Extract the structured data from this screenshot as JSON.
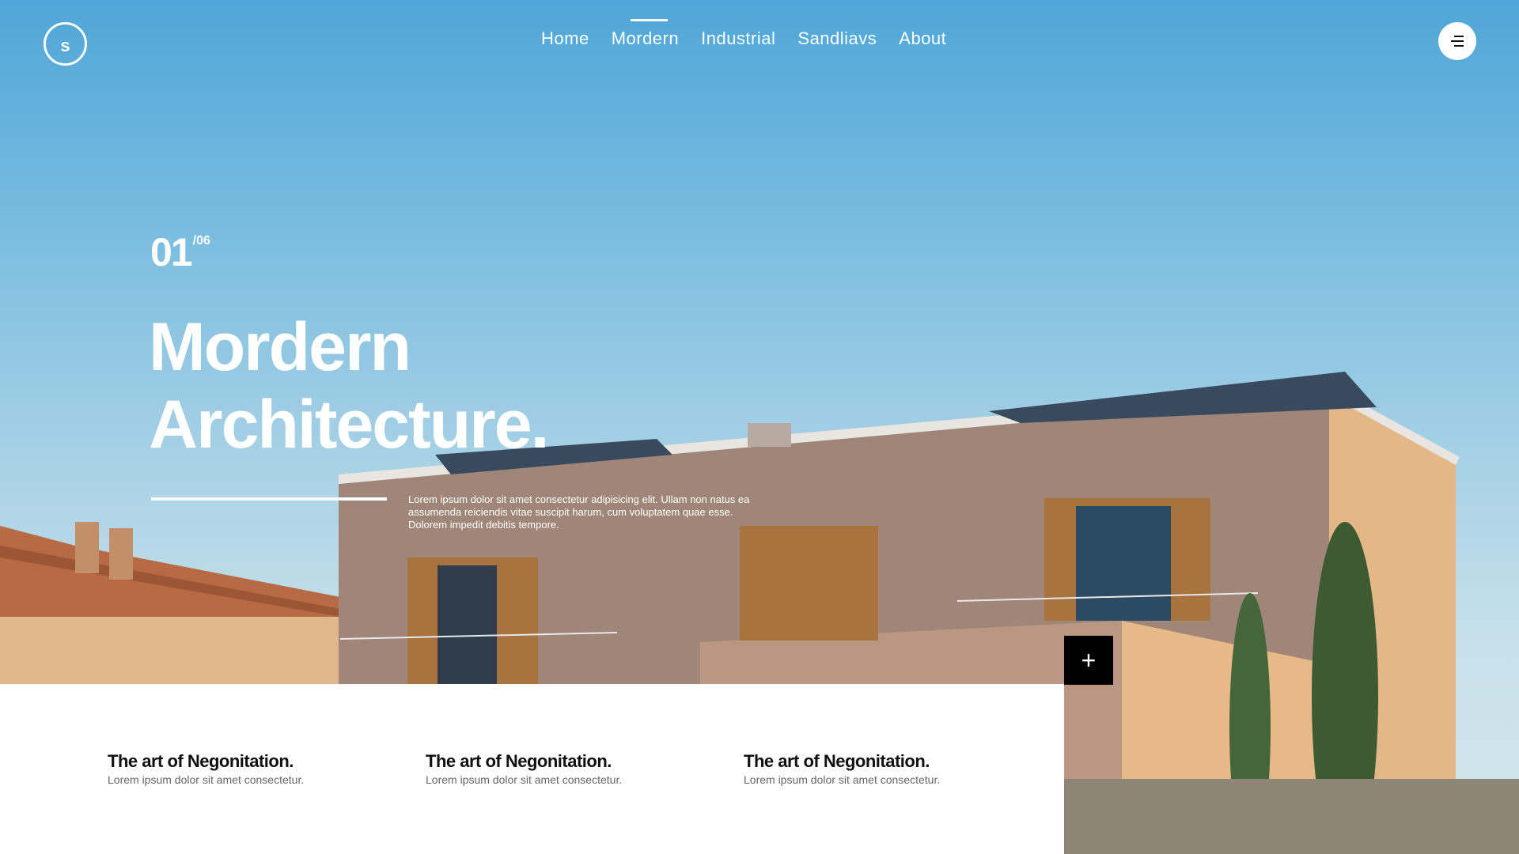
{
  "brand": {
    "logo_letter": "s"
  },
  "nav": {
    "items": [
      {
        "label": "Home"
      },
      {
        "label": "Mordern"
      },
      {
        "label": "Industrial"
      },
      {
        "label": "Sandliavs"
      },
      {
        "label": "About"
      }
    ],
    "active": "Mordern"
  },
  "hero": {
    "counter": {
      "current": "01",
      "total": "/06"
    },
    "title_line1": "Mordern",
    "title_line2": "Architecture.",
    "description": "Lorem ipsum dolor sit amet consectetur adipisicing elit. Ullam non natus ea assumenda reiciendis vitae suscipit harum, cum voluptatem quae esse. Dolorem impedit debitis tempore."
  },
  "features": [
    {
      "title": "The art of Negonitation.",
      "text": "Lorem ipsum dolor sit amet consectetur."
    },
    {
      "title": "The art of Negonitation.",
      "text": "Lorem ipsum dolor sit amet consectetur."
    },
    {
      "title": "The art of Negonitation.",
      "text": "Lorem ipsum dolor sit amet consectetur."
    }
  ],
  "plus_button": {
    "symbol": "+"
  },
  "icons": {
    "menu": "hamburger-menu-icon",
    "plus": "plus-icon",
    "logo": "logo-circle-icon"
  },
  "colors": {
    "sky_top": "#4fa6d8",
    "wall": "#c9a07a",
    "white": "#ffffff",
    "black": "#000000"
  }
}
